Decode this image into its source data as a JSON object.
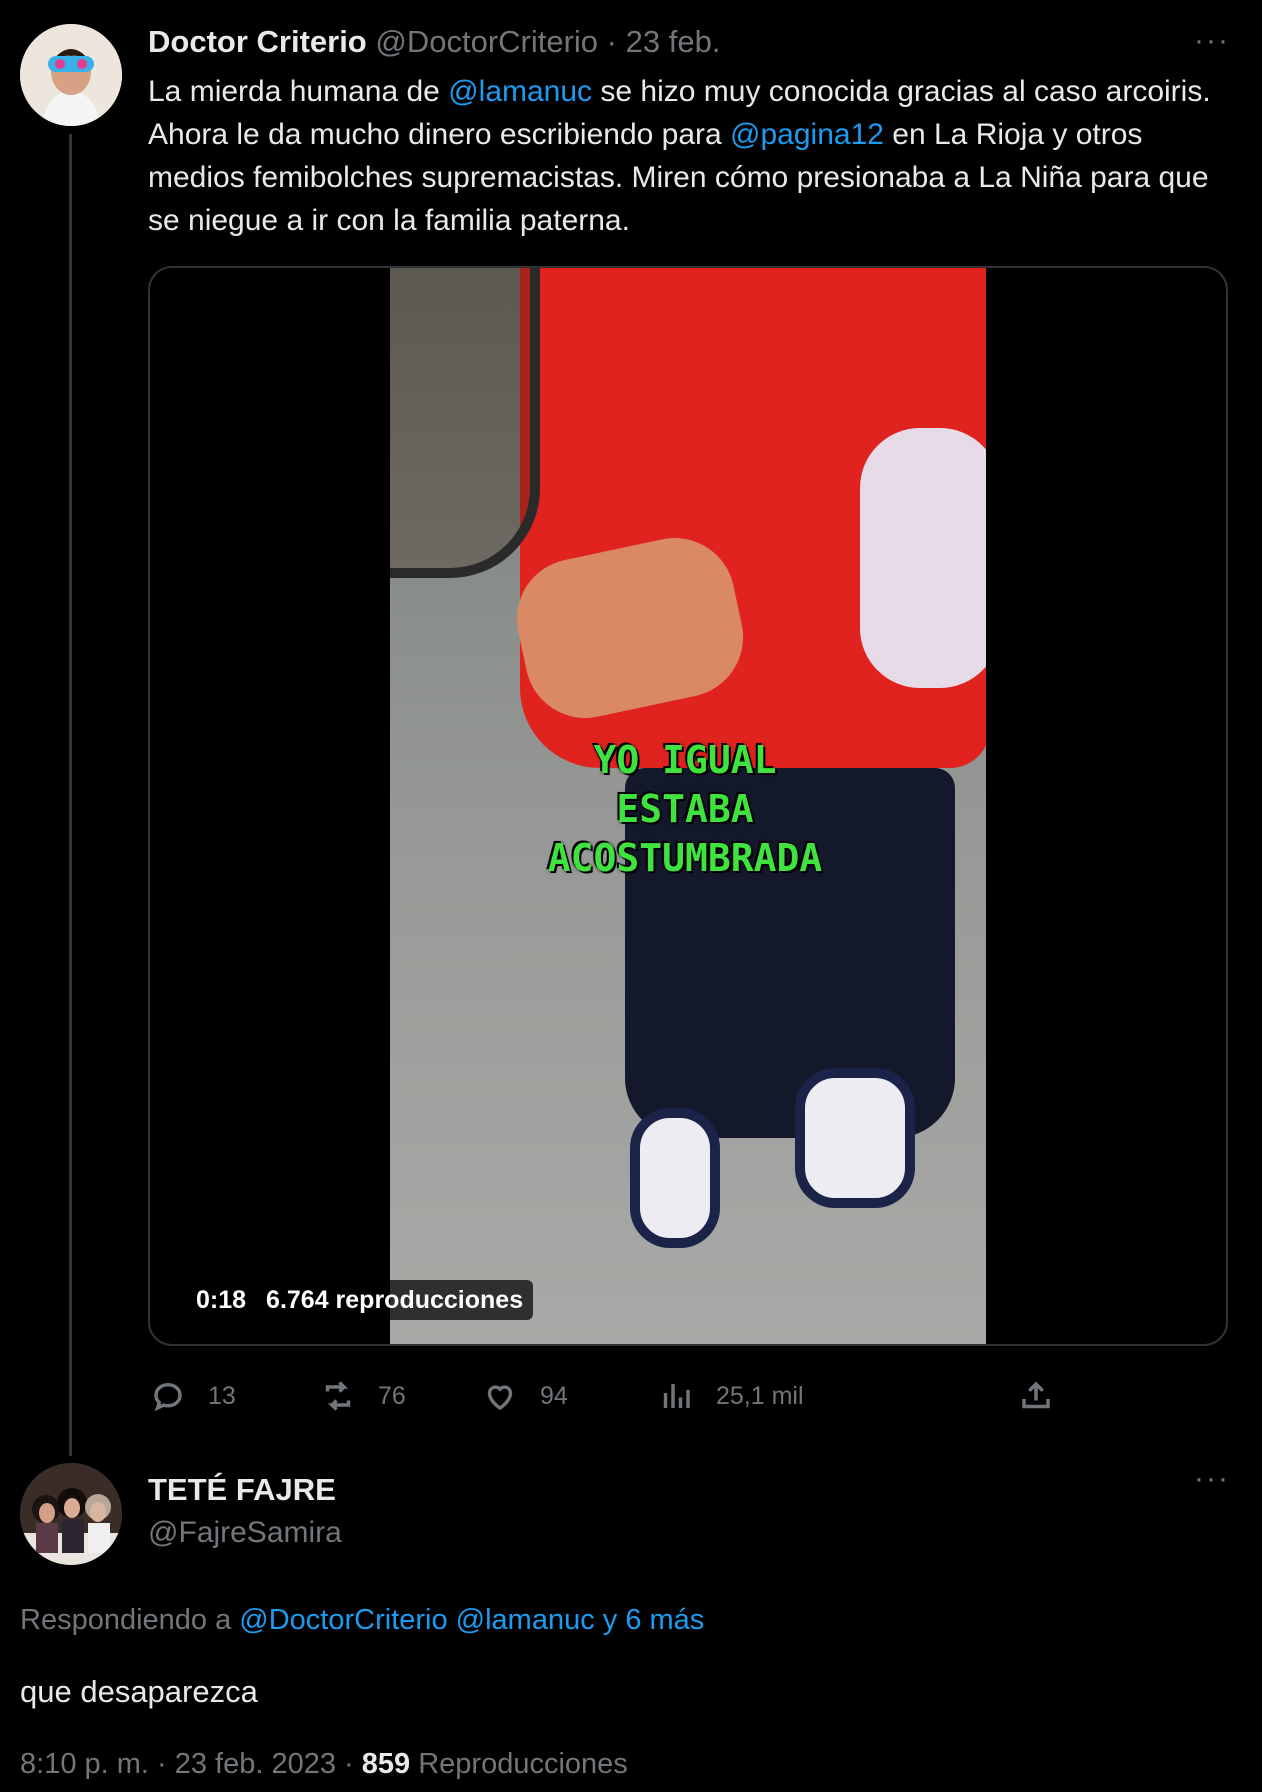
{
  "tweet1": {
    "display_name": "Doctor Criterio",
    "handle": "@DoctorCriterio",
    "sep": " · ",
    "date": "23 feb.",
    "more": "···",
    "body": {
      "p1": "La mierda humana de ",
      "m1": "@lamanuc",
      "p2": " se hizo muy conocida gracias al caso arcoiris. Ahora le da mucho dinero escribiendo para ",
      "m2": "@pagina12",
      "p3": " en La Rioja y otros medios femibolches supremacistas. Miren cómo presionaba a La Niña para que se niegue a ir con la familia paterna."
    },
    "video": {
      "caption_lines": [
        "YO IGUAL",
        "ESTABA",
        "ACOSTUMBRADA"
      ],
      "duration": "0:18",
      "views": "6.764 reproducciones"
    },
    "actions": {
      "replies": "13",
      "retweets": "76",
      "likes": "94",
      "views": "25,1 mil"
    }
  },
  "tweet2": {
    "display_name": "TETÉ FAJRE",
    "handle": "@FajreSamira",
    "more": "···",
    "replying_prefix": "Respondiendo a ",
    "replying_links": "@DoctorCriterio @lamanuc y 6 más",
    "body": "que desaparezca",
    "time": "8:10 p. m. · 23 feb. 2023 · ",
    "views_count": "859",
    "views_label": " Reproducciones"
  },
  "icons": [
    "reply-icon",
    "retweet-icon",
    "like-icon",
    "views-icon",
    "share-icon",
    "more-icon"
  ]
}
